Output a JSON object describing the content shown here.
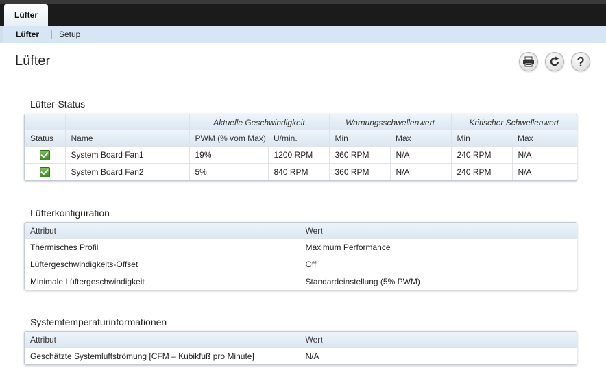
{
  "top_tab": "Lüfter",
  "subnav": {
    "active": "Lüfter",
    "setup": "Setup"
  },
  "page_title": "Lüfter",
  "toolbar": [
    "printer-icon",
    "refresh-icon",
    "help-icon"
  ],
  "fan_status": {
    "title": "Lüfter-Status",
    "groups": {
      "speed": "Aktuelle Geschwindigkeit",
      "warning": "Warnungsschwellenwert",
      "critical": "Kritischer Schwellenwert"
    },
    "columns": {
      "status": "Status",
      "name": "Name",
      "pwm": "PWM (% vom Max)",
      "rpm": "U/min.",
      "warn_min": "Min",
      "warn_max": "Max",
      "crit_min": "Min",
      "crit_max": "Max"
    },
    "rows": [
      {
        "status": "ok",
        "name": "System Board Fan1",
        "pwm": "19%",
        "rpm": "1200 RPM",
        "warn_min": "360 RPM",
        "warn_max": "N/A",
        "crit_min": "240 RPM",
        "crit_max": "N/A"
      },
      {
        "status": "ok",
        "name": "System Board Fan2",
        "pwm": "5%",
        "rpm": "840 RPM",
        "warn_min": "360 RPM",
        "warn_max": "N/A",
        "crit_min": "240 RPM",
        "crit_max": "N/A"
      }
    ]
  },
  "fan_config": {
    "title": "Lüfterkonfiguration",
    "columns": {
      "attribute": "Attribut",
      "value": "Wert"
    },
    "rows": [
      {
        "attribute": "Thermisches Profil",
        "value": "Maximum Performance"
      },
      {
        "attribute": "Lüftergeschwindigkeits-Offset",
        "value": "Off"
      },
      {
        "attribute": "Minimale Lüftergeschwindigkeit",
        "value": "Standardeinstellung (5% PWM)"
      }
    ]
  },
  "system_temp": {
    "title": "Systemtemperaturinformationen",
    "columns": {
      "attribute": "Attribut",
      "value": "Wert"
    },
    "rows": [
      {
        "attribute": "Geschätzte Systemluftströmung [CFM – Kubikfuß pro Minute]",
        "value": "N/A"
      }
    ]
  },
  "colors": {
    "top_bar": "#1b1b1b",
    "subnav": "#d7e6f4",
    "header": "#dbe7f2",
    "status_ok": "#3f8b24"
  }
}
